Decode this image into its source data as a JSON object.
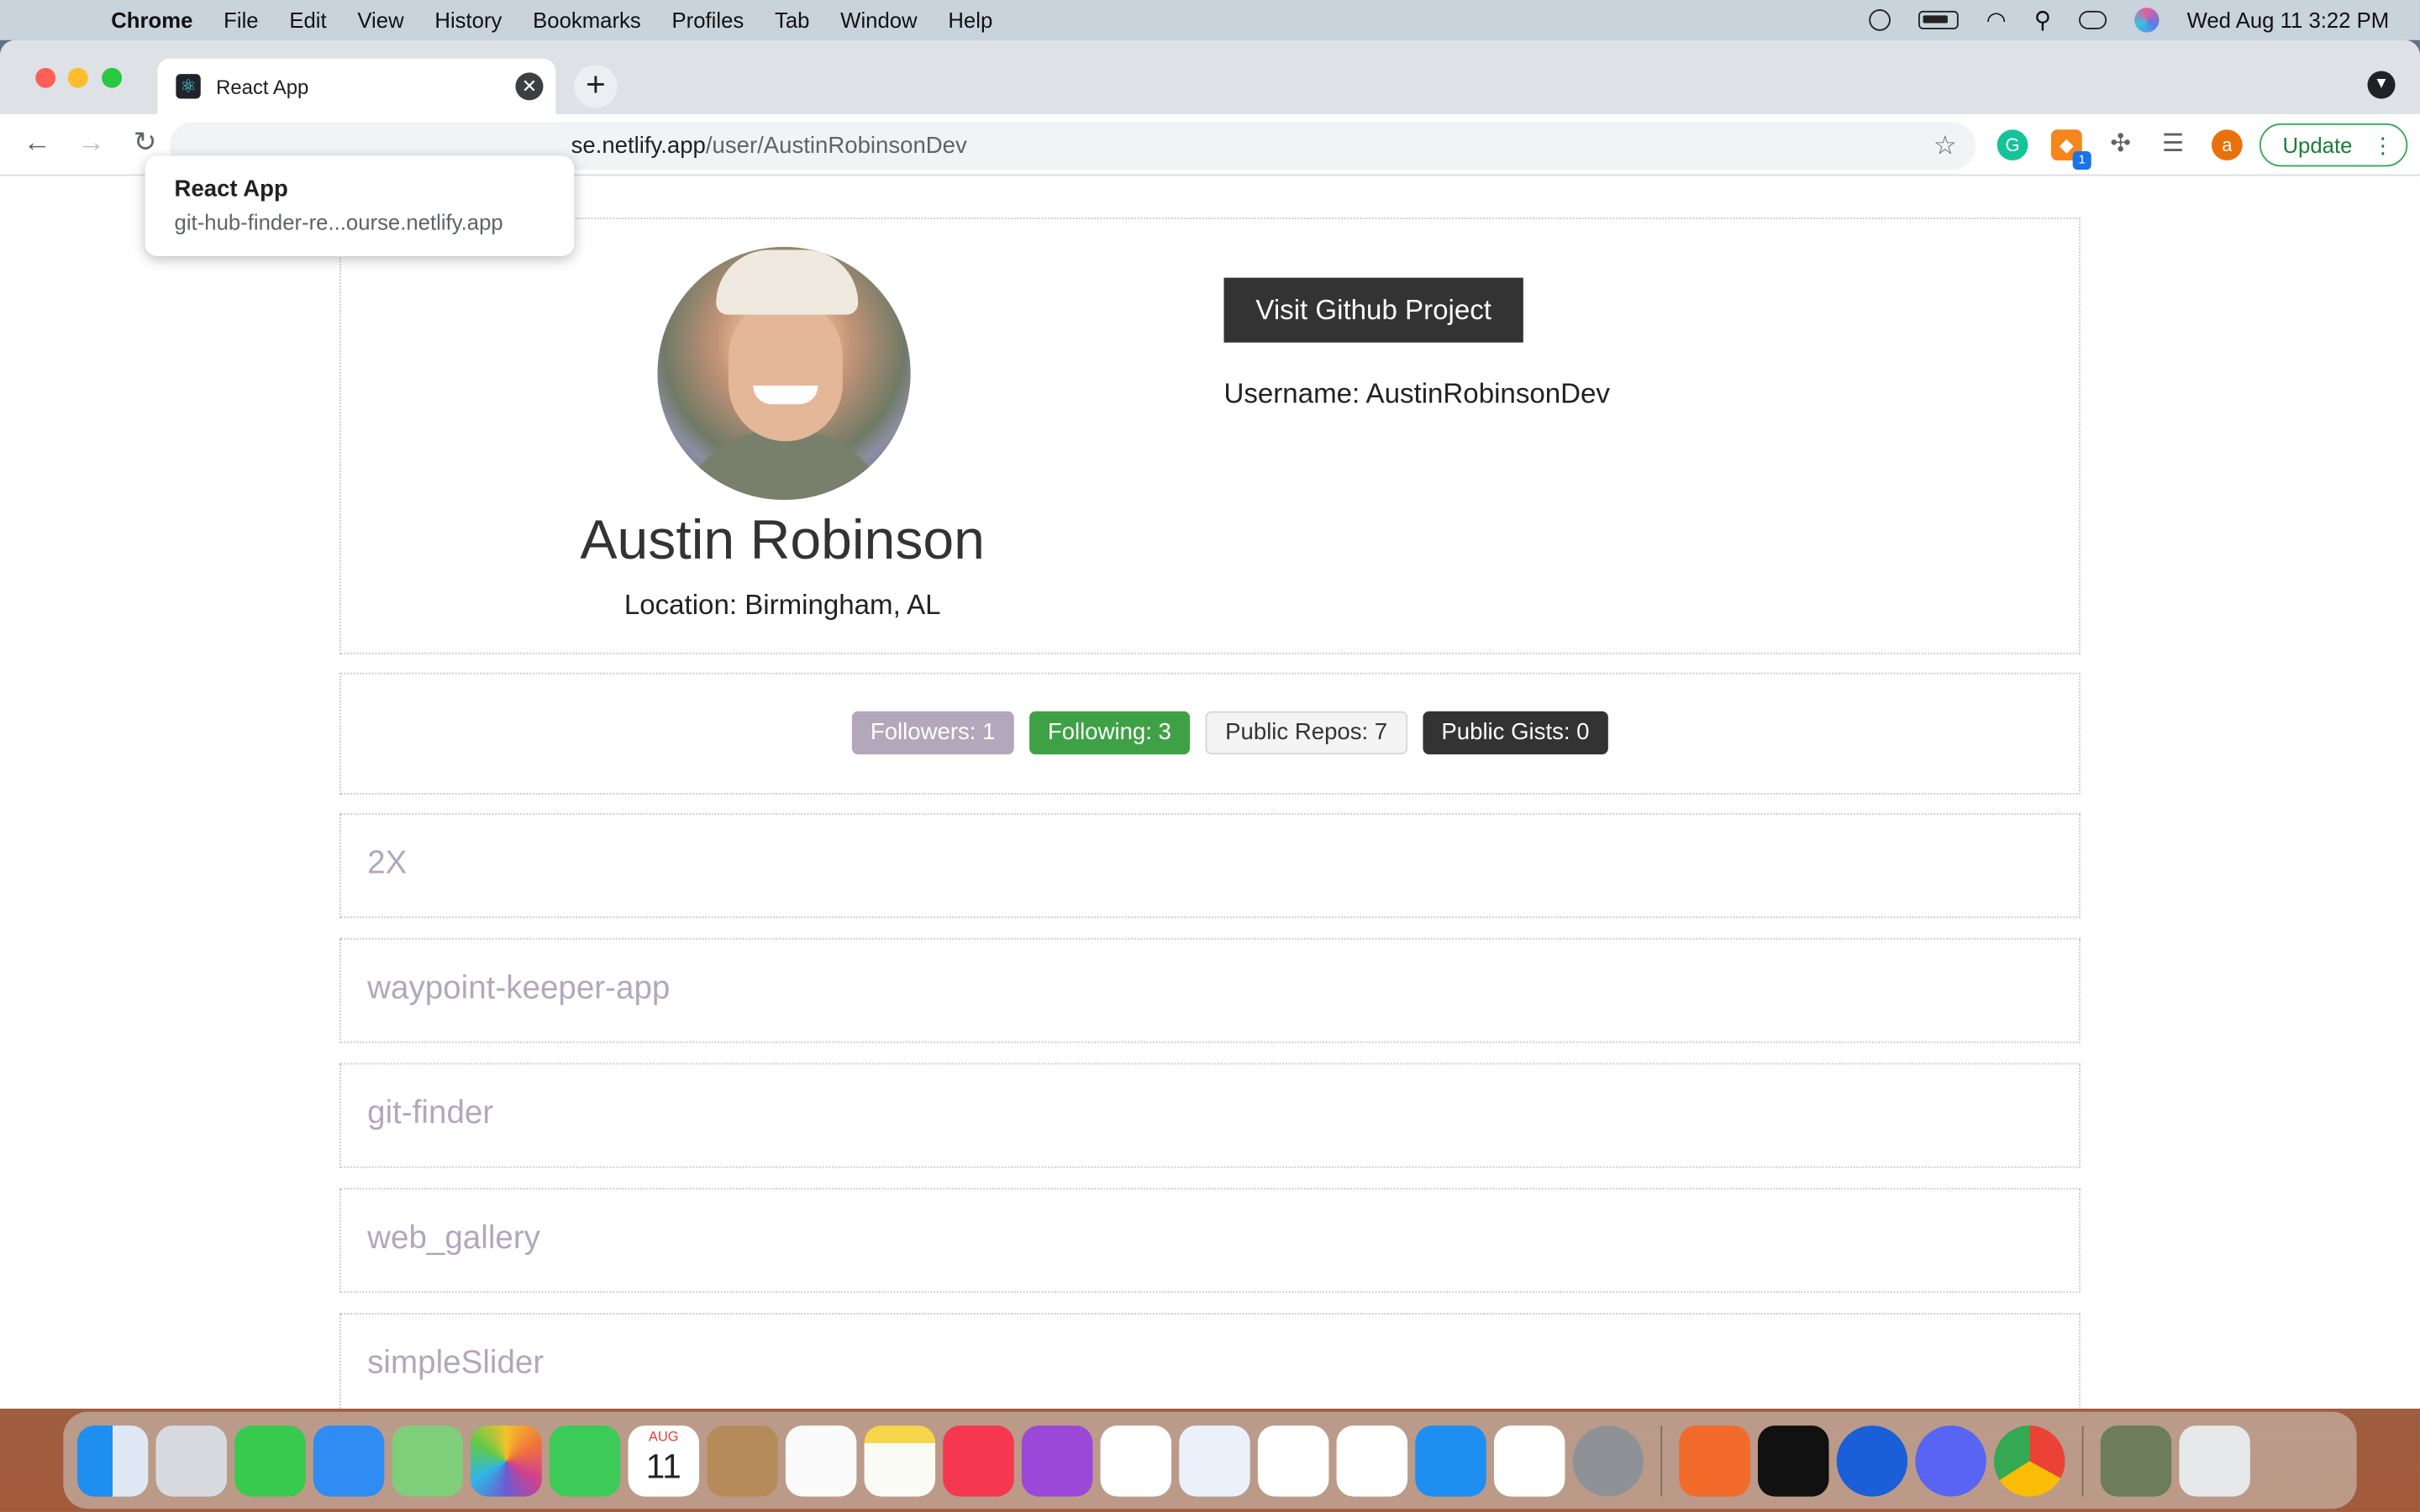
{
  "menubar": {
    "app": "Chrome",
    "items": [
      "File",
      "Edit",
      "View",
      "History",
      "Bookmarks",
      "Profiles",
      "Tab",
      "Window",
      "Help"
    ],
    "clock": "Wed Aug 11  3:22 PM"
  },
  "browser": {
    "tab_title": "React App",
    "url_host": "se.netlify.app",
    "url_path": "/user/AustinRobinsonDev",
    "update_label": "Update",
    "tooltip_title": "React App",
    "tooltip_url": "git-hub-finder-re...ourse.netlify.app",
    "profile_initial": "a",
    "fox_badge": "1"
  },
  "profile": {
    "name": "Austin Robinson",
    "location": "Location: Birmingham, AL",
    "visit_label": "Visit Github Project",
    "username": "Username: AustinRobinsonDev"
  },
  "stats": {
    "followers": "Followers: 1",
    "following": "Following: 3",
    "public_repos": "Public Repos: 7",
    "public_gists": "Public Gists: 0"
  },
  "repos": [
    "2X",
    "waypoint-keeper-app",
    "git-finder",
    "web_gallery",
    "simpleSlider"
  ],
  "dock": {
    "calendar_month": "AUG",
    "calendar_day": "11",
    "apps": [
      "finder",
      "launchpad",
      "messages",
      "mail",
      "maps",
      "photos",
      "facetime",
      "calendar",
      "contacts",
      "reminders",
      "notes",
      "music",
      "podcasts",
      "news",
      "keynote",
      "numbers",
      "pages",
      "app-store",
      "vscode",
      "system-preferences",
      "sketch",
      "terminal",
      "sourcetree",
      "discord",
      "chrome",
      "preview",
      "trash"
    ]
  },
  "colors": {
    "accent_purple": "#b3a7bb",
    "following_green": "#3fa146",
    "dark": "#333333"
  }
}
